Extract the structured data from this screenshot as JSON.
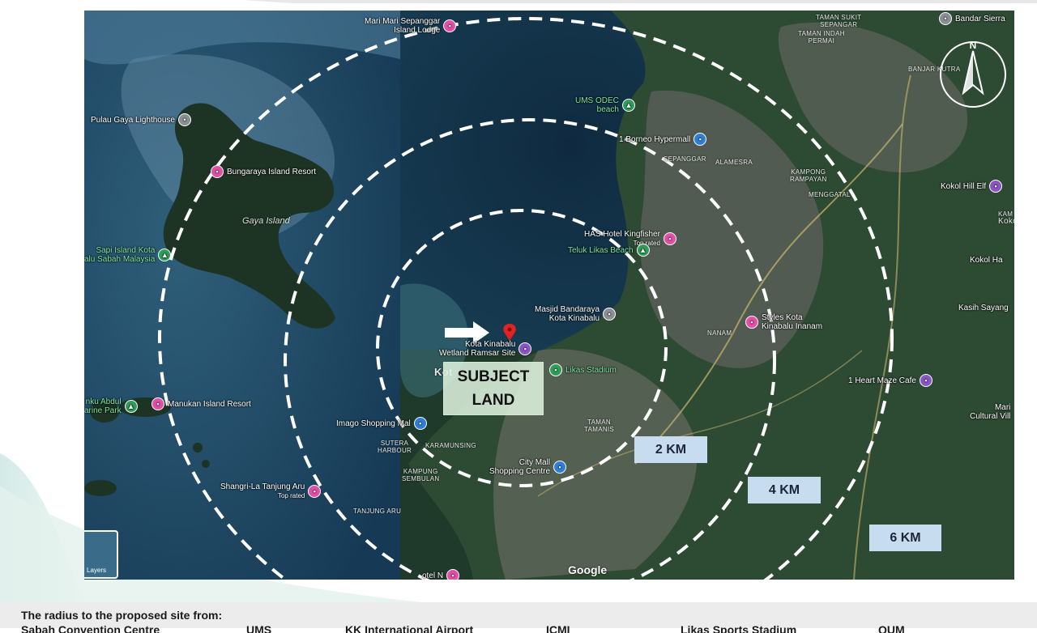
{
  "map": {
    "pois": [
      {
        "name": "Mari Mari Sepanggar Island Lodge",
        "lines": [
          "Mari Mari Sepanggar",
          "Island Lodge"
        ],
        "type": "pink"
      },
      {
        "name": "Bandar Sierra",
        "lines": [
          "Bandar Sierra"
        ],
        "type": "grey"
      },
      {
        "name": "UMS ODEC beach",
        "lines": [
          "UMS ODEC",
          "beach"
        ],
        "type": "green"
      },
      {
        "name": "1 Borneo Hypermall",
        "lines": [
          "1 Borneo Hypermall"
        ],
        "type": "blue"
      },
      {
        "name": "Pulau Gaya Lighthouse",
        "lines": [
          "Pulau Gaya Lighthouse"
        ],
        "type": "grey"
      },
      {
        "name": "Bungaraya Island Resort",
        "lines": [
          "Bungaraya Island Resort"
        ],
        "type": "pink"
      },
      {
        "name": "Kokol Hill Elf",
        "lines": [
          "Kokol Hill Elf"
        ],
        "type": "purple"
      },
      {
        "name": "Sapi Island Kota Kinabalu Sabah Malaysia",
        "lines": [
          "Sapi Island Kota",
          "alu Sabah Malaysia"
        ],
        "type": "green"
      },
      {
        "name": "HAS Hotel Kingfisher",
        "lines": [
          "HAS Hotel Kingfisher",
          "Top rated"
        ],
        "type": "pink"
      },
      {
        "name": "Teluk Likas Beach",
        "lines": [
          "Teluk Likas Beach"
        ],
        "type": "green"
      },
      {
        "name": "Kokol Ha",
        "lines": [
          "Kokol Ha"
        ],
        "type": "none"
      },
      {
        "name": "Masjid Bandaraya Kota Kinabalu",
        "lines": [
          "Masjid Bandaraya",
          "Kota Kinabalu"
        ],
        "type": "grey"
      },
      {
        "name": "Kasih Sayang",
        "lines": [
          "Kasih Sayang"
        ],
        "type": "none"
      },
      {
        "name": "Kota Kinabalu Wetland Ramsar Site",
        "lines": [
          "Kota Kinabalu",
          "Wetland Ramsar Site"
        ],
        "type": "purple"
      },
      {
        "name": "Styles Kota Kinabalu Inanam",
        "lines": [
          "Styles Kota",
          "Kinabalu Inanam"
        ],
        "type": "pink"
      },
      {
        "name": "Likas Stadium",
        "lines": [
          "Likas Stadium"
        ],
        "type": "green"
      },
      {
        "name": "1 Heart Maze Cafe",
        "lines": [
          "1 Heart Maze Cafe"
        ],
        "type": "purple"
      },
      {
        "name": "Tunku Abdul Rahman Marine Park",
        "lines": [
          "nku Abdul",
          "arine Park"
        ],
        "type": "green"
      },
      {
        "name": "Manukan Island Resort",
        "lines": [
          "Manukan Island Resort"
        ],
        "type": "pink"
      },
      {
        "name": "Mari Mari Cultural Village",
        "lines": [
          "Mari",
          "Cultural Vill"
        ],
        "type": "none"
      },
      {
        "name": "Imago Shopping Mall",
        "lines": [
          "Imago Shopping Mal"
        ],
        "type": "blue"
      },
      {
        "name": "City Mall Shopping Centre",
        "lines": [
          "City Mall",
          "Shopping Centre"
        ],
        "type": "blue"
      },
      {
        "name": "Shangri-La Tanjung Aru",
        "lines": [
          "Shangri-La Tanjung Aru",
          "Top rated"
        ],
        "type": "pink"
      },
      {
        "name": "Hotel Nexus",
        "lines": [
          "otel N"
        ],
        "type": "pink"
      }
    ],
    "area_labels": [
      {
        "name": "taman-sukit-sepangar",
        "lines": [
          "TAMAN SUKIT",
          "SEPANGAR"
        ]
      },
      {
        "name": "taman-indah-permai",
        "lines": [
          "TAMAN INDAH",
          "PERMAI"
        ]
      },
      {
        "name": "banjar-kutra",
        "lines": [
          "BANJAR KUTRA"
        ]
      },
      {
        "name": "sepanggar",
        "lines": [
          "SEPANGGAR"
        ]
      },
      {
        "name": "alamesra",
        "lines": [
          "ALAMESRA"
        ]
      },
      {
        "name": "kampong-rampayan",
        "lines": [
          "KAMPONG",
          "RAMPAYAN"
        ]
      },
      {
        "name": "menggatal",
        "lines": [
          "MENGGATAL"
        ]
      },
      {
        "name": "kam-koko",
        "lines": [
          "KAM",
          "Koko"
        ]
      },
      {
        "name": "nanam",
        "lines": [
          "NANAM"
        ]
      },
      {
        "name": "taman-tamanis",
        "lines": [
          "TAMAN",
          "TAMANIS"
        ]
      },
      {
        "name": "sutera-harbour",
        "lines": [
          "SUTERA",
          "HARBOUR"
        ]
      },
      {
        "name": "karamunsing",
        "lines": [
          "KARAMUNSING"
        ]
      },
      {
        "name": "kampung-sembulan",
        "lines": [
          "KAMPUNG",
          "SEMBULAN"
        ]
      },
      {
        "name": "tanjung-aru",
        "lines": [
          "TANJUNG ARU"
        ]
      },
      {
        "name": "kot",
        "lines": [
          "Kot"
        ]
      }
    ],
    "island_label": "Gaya Island",
    "subject": {
      "line1": "SUBJECT",
      "line2": "LAND"
    },
    "radius_labels": {
      "r2": "2 KM",
      "r4": "4 KM",
      "r6": "6 KM"
    },
    "compass_letter": "N",
    "layers_label": "Layers",
    "attribution": "Google",
    "colors": {
      "ring": "#ffffff",
      "label_bg": "#c8dcef",
      "subject_marker": "#e02424"
    }
  },
  "footer": {
    "title": "The radius to the proposed site from:",
    "row_fragments": [
      "Sabah Convention Centre",
      "UMS",
      "KK International Airport",
      "ICMI",
      "Likas Sports Stadium",
      "QUM"
    ]
  }
}
